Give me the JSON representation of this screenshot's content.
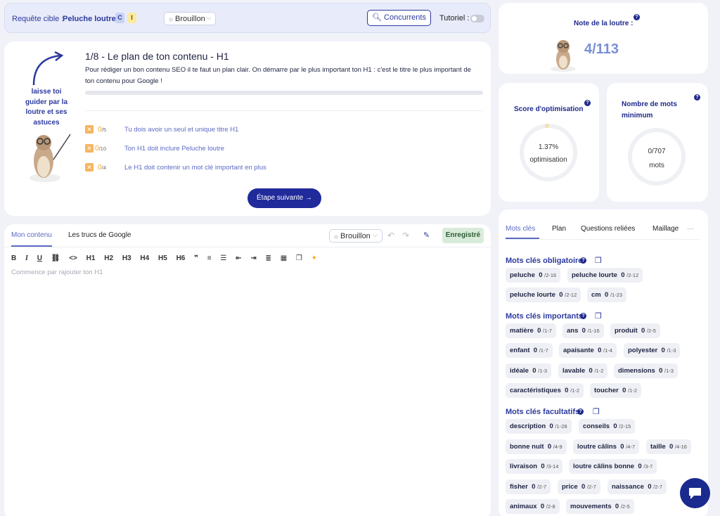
{
  "topbar": {
    "target_label": "Requête cible :",
    "target_query": "Peluche loutre",
    "badge_c": "C",
    "badge_i": "I",
    "status": "Brouillon",
    "competitors_btn": "Concurrents",
    "tutorial_label": "Tutoriel :"
  },
  "plan": {
    "title": "1/8 - Le plan de ton contenu - H1",
    "description": "Pour rédiger un bon contenu SEO il te faut un plan clair. On démarre par le plus important ton H1 : c'est le titre le plus important de ton contenu pour Google !",
    "progress": 0,
    "guide_text": "laisse toi guider par la loutre et ses astuces",
    "checks": [
      {
        "score": "0",
        "max": "/5",
        "text": "Tu dois avoir un seul et unique titre H1"
      },
      {
        "score": "0",
        "max": "/10",
        "text": "Ton H1 doit inclure Peluche loutre"
      },
      {
        "score": "0",
        "max": "/4",
        "text": "Le H1 doit contenir un mot clé important en plus"
      }
    ],
    "next_btn": "Étape suivante"
  },
  "editor": {
    "tabs": [
      "Mon contenu",
      "Les trucs de Google"
    ],
    "status": "Brouillon",
    "saved": "Enregistré",
    "toolbar": [
      "B",
      "I",
      "U",
      "⛓",
      "<>",
      "H1",
      "H2",
      "H3",
      "H4",
      "H5",
      "H6",
      "❞",
      "≡",
      "☰",
      "⇤",
      "⇥",
      "≣",
      "▦",
      "❐",
      "✦"
    ],
    "placeholder": "Commence par rajouter ton H1"
  },
  "note": {
    "title": "Note de la loutre :",
    "value": "4/113"
  },
  "optimization": {
    "title": "Score d'optimisation",
    "value": "1.37%",
    "unit": "optimisation"
  },
  "word_count": {
    "title": "Nombre de mots minimum",
    "value": "0/707",
    "unit": "mots"
  },
  "keywords": {
    "tabs": [
      "Mots clés",
      "Plan",
      "Questions reliées",
      "Maillage",
      "···"
    ],
    "sections": [
      {
        "title": "Mots clés obligatoire",
        "items": [
          {
            "word": "peluche",
            "count": "0",
            "range": "/2-16"
          },
          {
            "word": "peluche lourte",
            "count": "0",
            "range": "/2-12"
          },
          {
            "word": "peluche lourte",
            "count": "0",
            "range": "/2-12"
          },
          {
            "word": "cm",
            "count": "0",
            "range": "/1-23"
          }
        ]
      },
      {
        "title": "Mots clés importants",
        "items": [
          {
            "word": "matière",
            "count": "0",
            "range": "/1-7"
          },
          {
            "word": "ans",
            "count": "0",
            "range": "/1-16"
          },
          {
            "word": "produit",
            "count": "0",
            "range": "/2-5"
          },
          {
            "word": "enfant",
            "count": "0",
            "range": "/1-7"
          },
          {
            "word": "apaisante",
            "count": "0",
            "range": "/1-4"
          },
          {
            "word": "polyester",
            "count": "0",
            "range": "/1-3"
          },
          {
            "word": "idéale",
            "count": "0",
            "range": "/1-3"
          },
          {
            "word": "lavable",
            "count": "0",
            "range": "/1-2"
          },
          {
            "word": "dimensions",
            "count": "0",
            "range": "/1-3"
          },
          {
            "word": "caractéristiques",
            "count": "0",
            "range": "/1-2"
          },
          {
            "word": "toucher",
            "count": "0",
            "range": "/1-2"
          }
        ]
      },
      {
        "title": "Mots clés facultatifs",
        "items": [
          {
            "word": "description",
            "count": "0",
            "range": "/1-28"
          },
          {
            "word": "conseils",
            "count": "0",
            "range": "/2-15"
          },
          {
            "word": "bonne nuit",
            "count": "0",
            "range": "/4-9"
          },
          {
            "word": "loutre câlins",
            "count": "0",
            "range": "/4-7"
          },
          {
            "word": "taille",
            "count": "0",
            "range": "/4-16"
          },
          {
            "word": "livraison",
            "count": "0",
            "range": "/3-14"
          },
          {
            "word": "loutre câlins bonne",
            "count": "0",
            "range": "/3-7"
          },
          {
            "word": "fisher",
            "count": "0",
            "range": "/2-7"
          },
          {
            "word": "price",
            "count": "0",
            "range": "/2-7"
          },
          {
            "word": "naissance",
            "count": "0",
            "range": "/2-7"
          },
          {
            "word": "animaux",
            "count": "0",
            "range": "/2-8"
          },
          {
            "word": "mouvements",
            "count": "0",
            "range": "/2-5"
          }
        ]
      }
    ]
  },
  "colors": {
    "accent": "#2d3a9e",
    "primary": "#202a9a",
    "warning": "#f5b55f",
    "saved_bg": "#d9ecdb"
  }
}
